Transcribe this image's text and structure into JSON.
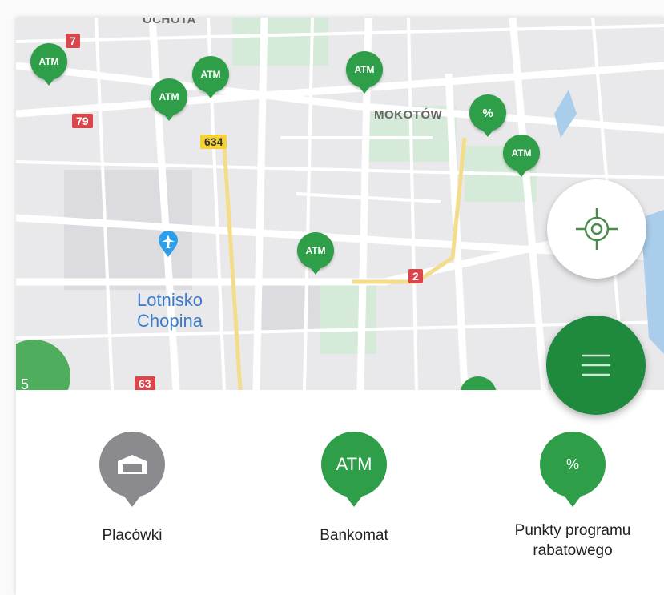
{
  "map": {
    "district_labels": [
      "OCHOTA",
      "MOKOTÓW"
    ],
    "place_label_line1": "Lotnisko",
    "place_label_line2": "Chopina",
    "road_shields": [
      "7",
      "79",
      "634",
      "2",
      "63"
    ],
    "atm_pin_label": "ATM",
    "discount_pin_label": "%",
    "cluster_count": "5",
    "colors": {
      "pin_green": "#2e9e48",
      "menu_green": "#1f8a3d",
      "place_blue": "#3b7bc9",
      "branch_gray": "#8b8b8f"
    }
  },
  "controls": {
    "locate_icon": "crosshair-icon",
    "menu_icon": "hamburger-icon"
  },
  "legend": {
    "items": [
      {
        "label": "Placówki",
        "icon": "bank-branch-icon",
        "icon_text": ""
      },
      {
        "label": "Bankomat",
        "icon": "atm-icon",
        "icon_text": "ATM"
      },
      {
        "label_line1": "Punkty programu",
        "label_line2": "rabatowego",
        "icon": "discount-icon",
        "icon_text": "%"
      }
    ]
  }
}
